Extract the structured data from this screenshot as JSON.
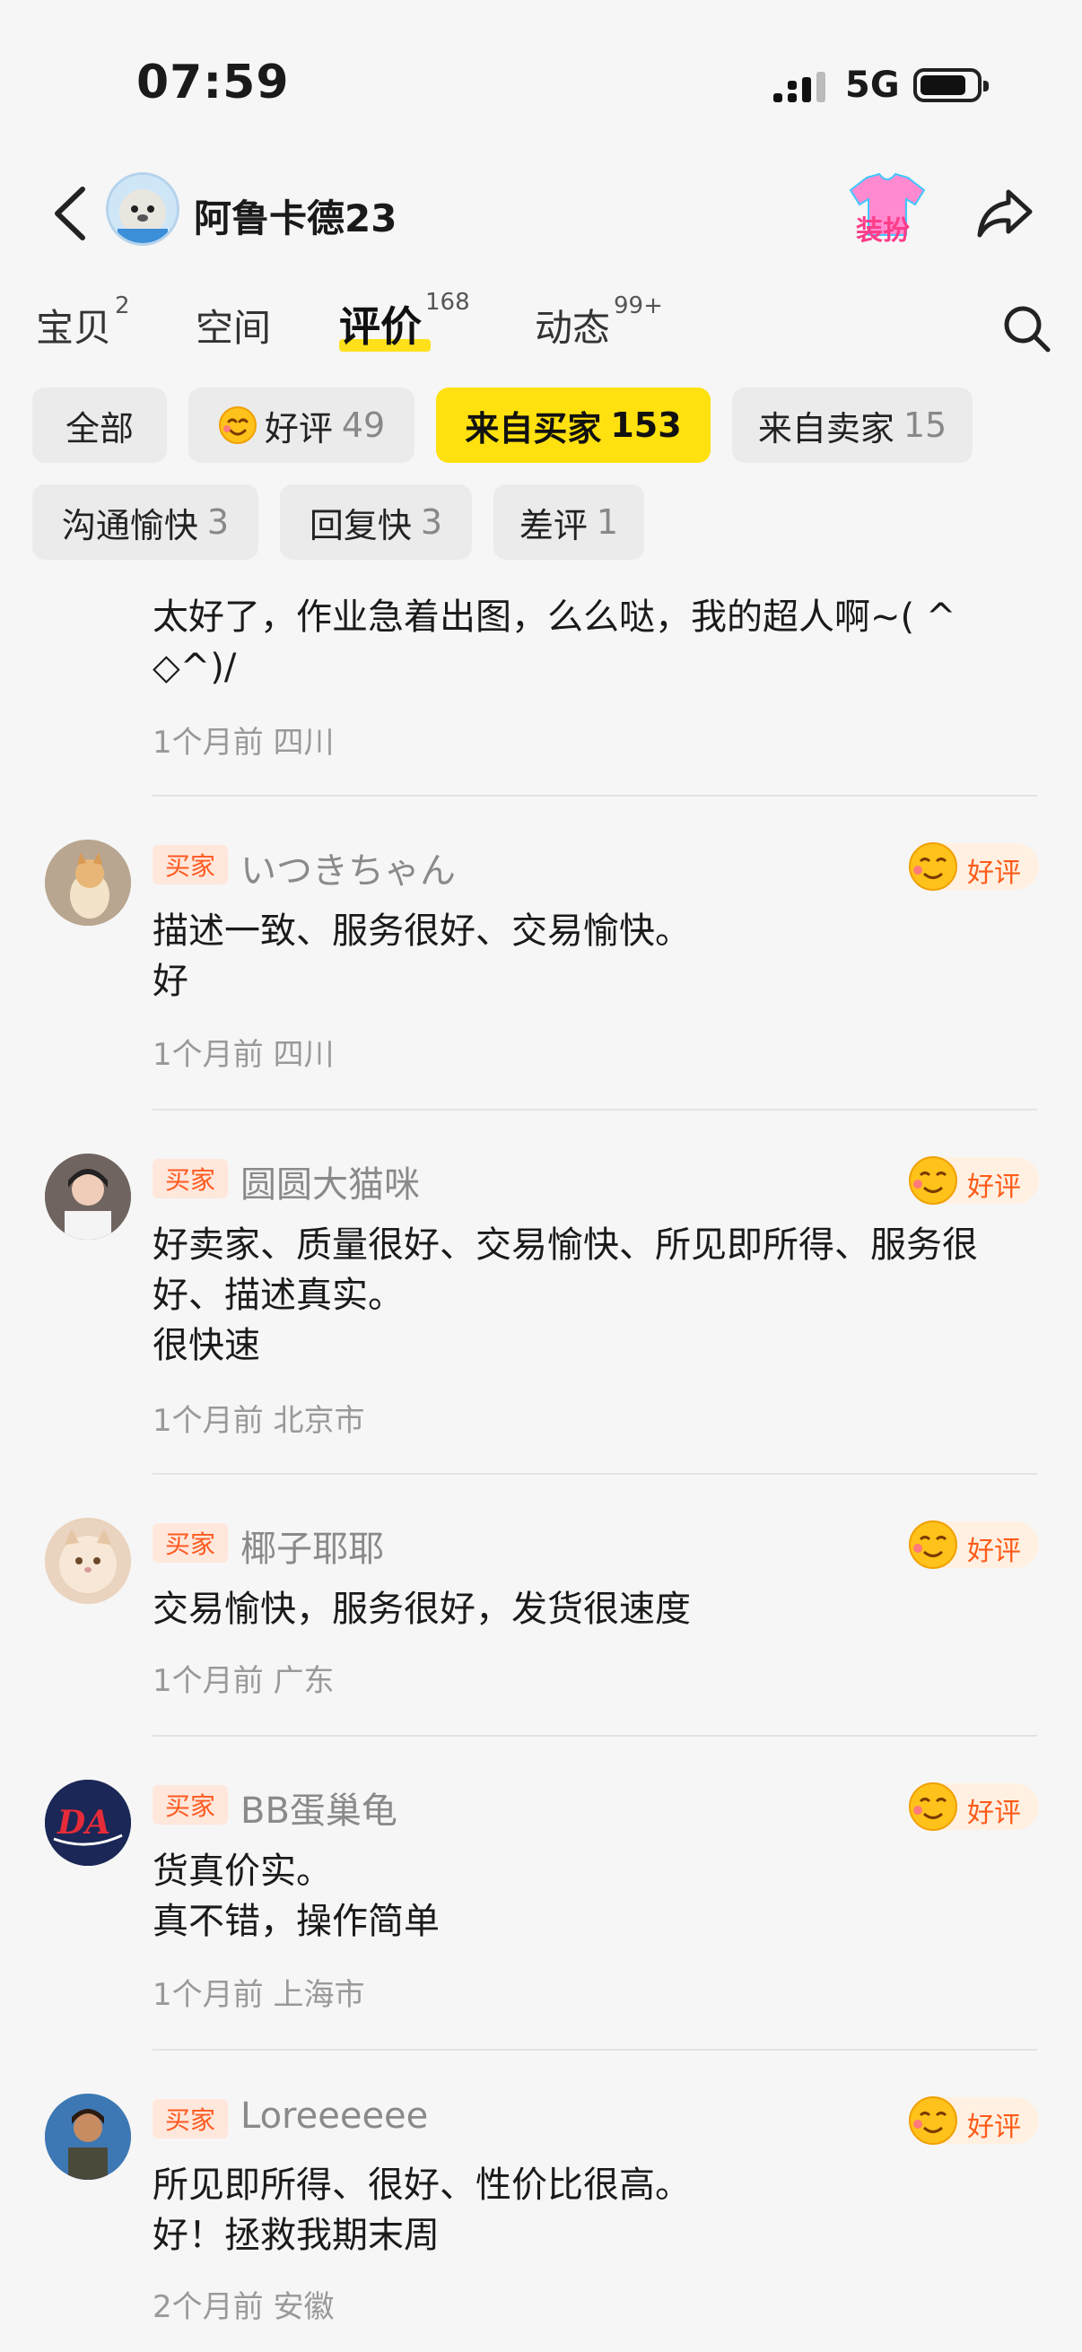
{
  "status": {
    "time": "07:59",
    "network": "5G"
  },
  "header": {
    "name": "阿鲁卡德23",
    "dress_label": "装扮"
  },
  "tabs": [
    {
      "label": "宝贝",
      "count": "2"
    },
    {
      "label": "空间",
      "count": ""
    },
    {
      "label": "评价",
      "count": "168"
    },
    {
      "label": "动态",
      "count": "99+"
    }
  ],
  "filters": [
    {
      "label": "全部",
      "count": ""
    },
    {
      "label": "好评",
      "count": "49"
    },
    {
      "label": "来自买家",
      "count": "153"
    },
    {
      "label": "来自卖家",
      "count": "15"
    },
    {
      "label": "沟通愉快",
      "count": "3"
    },
    {
      "label": "回复快",
      "count": "3"
    },
    {
      "label": "差评",
      "count": "1"
    }
  ],
  "badge_label": "买家",
  "good_label": "好评",
  "partial_review": {
    "line1": "太好了，作业急着出图，么么哒，我的超人啊~( ^",
    "line2": "◇^)/",
    "meta": "1个月前 四川"
  },
  "reviews": [
    {
      "user": "いつきちゃん",
      "lines": [
        "描述一致、服务很好、交易愉快。",
        "好"
      ],
      "meta": "1个月前 四川"
    },
    {
      "user": "圆圆大猫咪",
      "lines": [
        "好卖家、质量很好、交易愉快、所见即所得、服务很",
        "好、描述真实。",
        "很快速"
      ],
      "meta": "1个月前 北京市"
    },
    {
      "user": "椰子耶耶",
      "lines": [
        "交易愉快，服务很好，发货很速度"
      ],
      "meta": "1个月前 广东"
    },
    {
      "user": "BB蛋巢龟",
      "lines": [
        "货真价实。",
        "真不错，操作简单"
      ],
      "meta": "1个月前 上海市"
    },
    {
      "user": "Loreeeeee",
      "lines": [
        "所见即所得、很好、性价比很高。",
        "好！拯救我期末周"
      ],
      "meta": "2个月前 安徽"
    }
  ],
  "colors": {
    "accent_yellow": "#ffe10f",
    "badge_orange": "#ff5a1f",
    "page_bg": "#f6f6f6"
  }
}
